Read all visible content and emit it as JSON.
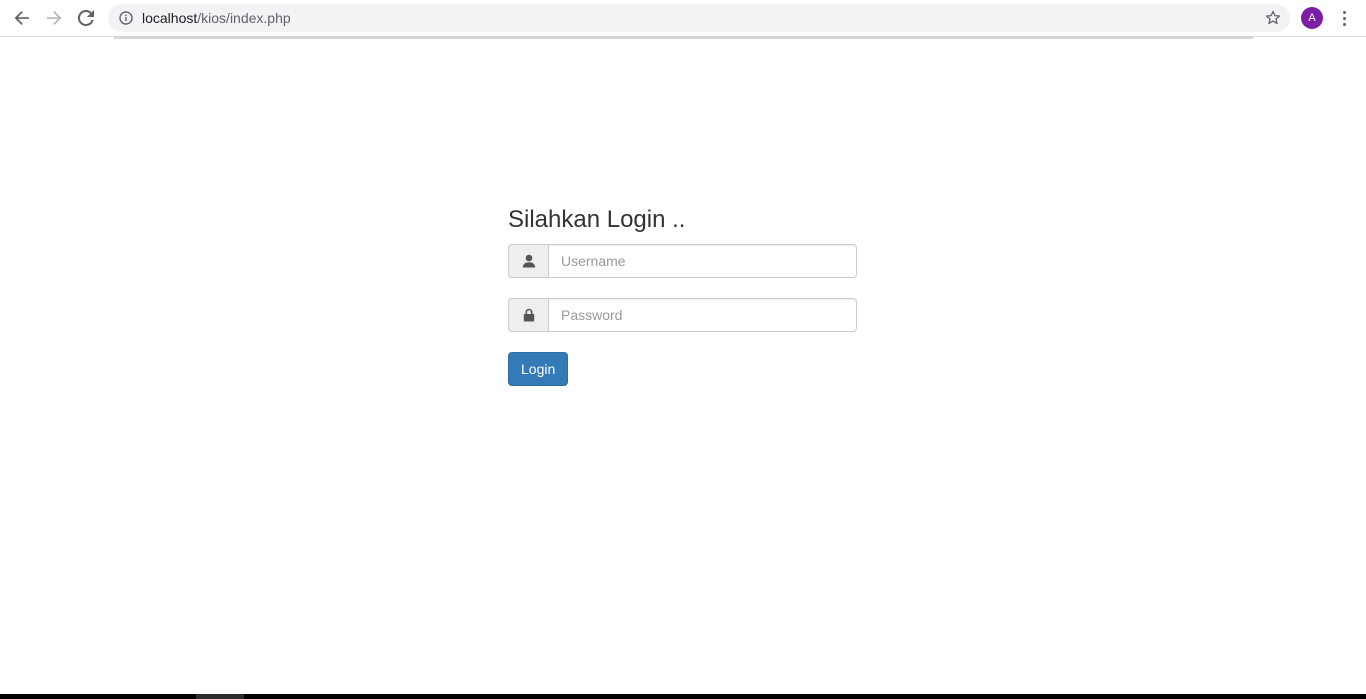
{
  "browser": {
    "url_host": "localhost",
    "url_path": "/kios/index.php",
    "avatar_letter": "A",
    "avatar_color": "#7b1fa2"
  },
  "login": {
    "title": "Silahkan Login ..",
    "username_placeholder": "Username",
    "username_value": "",
    "username_icon": "user-icon",
    "password_placeholder": "Password",
    "password_value": "",
    "password_icon": "lock-icon",
    "button_label": "Login",
    "button_color": "#337ab7"
  }
}
